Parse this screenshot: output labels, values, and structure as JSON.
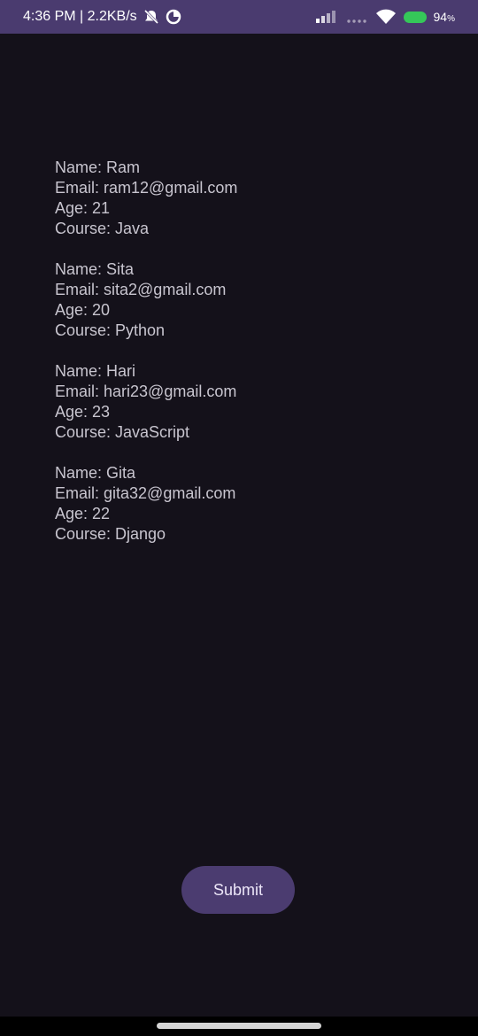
{
  "status_bar": {
    "time_speed": "4:36 PM | 2.2KB/s",
    "battery_percent": "94",
    "battery_unit": "%"
  },
  "students": [
    {
      "name": "Name: Ram",
      "email": "Email: ram12@gmail.com",
      "age": "Age: 21",
      "course": "Course: Java"
    },
    {
      "name": "Name: Sita",
      "email": "Email: sita2@gmail.com",
      "age": "Age: 20",
      "course": "Course: Python"
    },
    {
      "name": "Name: Hari",
      "email": "Email: hari23@gmail.com",
      "age": "Age: 23",
      "course": "Course: JavaScript"
    },
    {
      "name": "Name: Gita",
      "email": "Email: gita32@gmail.com",
      "age": "Age: 22",
      "course": "Course: Django"
    }
  ],
  "submit_label": "Submit",
  "icons": {
    "mute": "mute-icon",
    "vpn": "vpn-icon",
    "signal": "signal-icon",
    "wifi": "wifi-icon",
    "battery": "battery-icon"
  },
  "colors": {
    "status_bar_bg": "#4a3b6f",
    "background": "#14111a",
    "button_bg": "#4b3c70",
    "text": "#c8c5cf"
  }
}
